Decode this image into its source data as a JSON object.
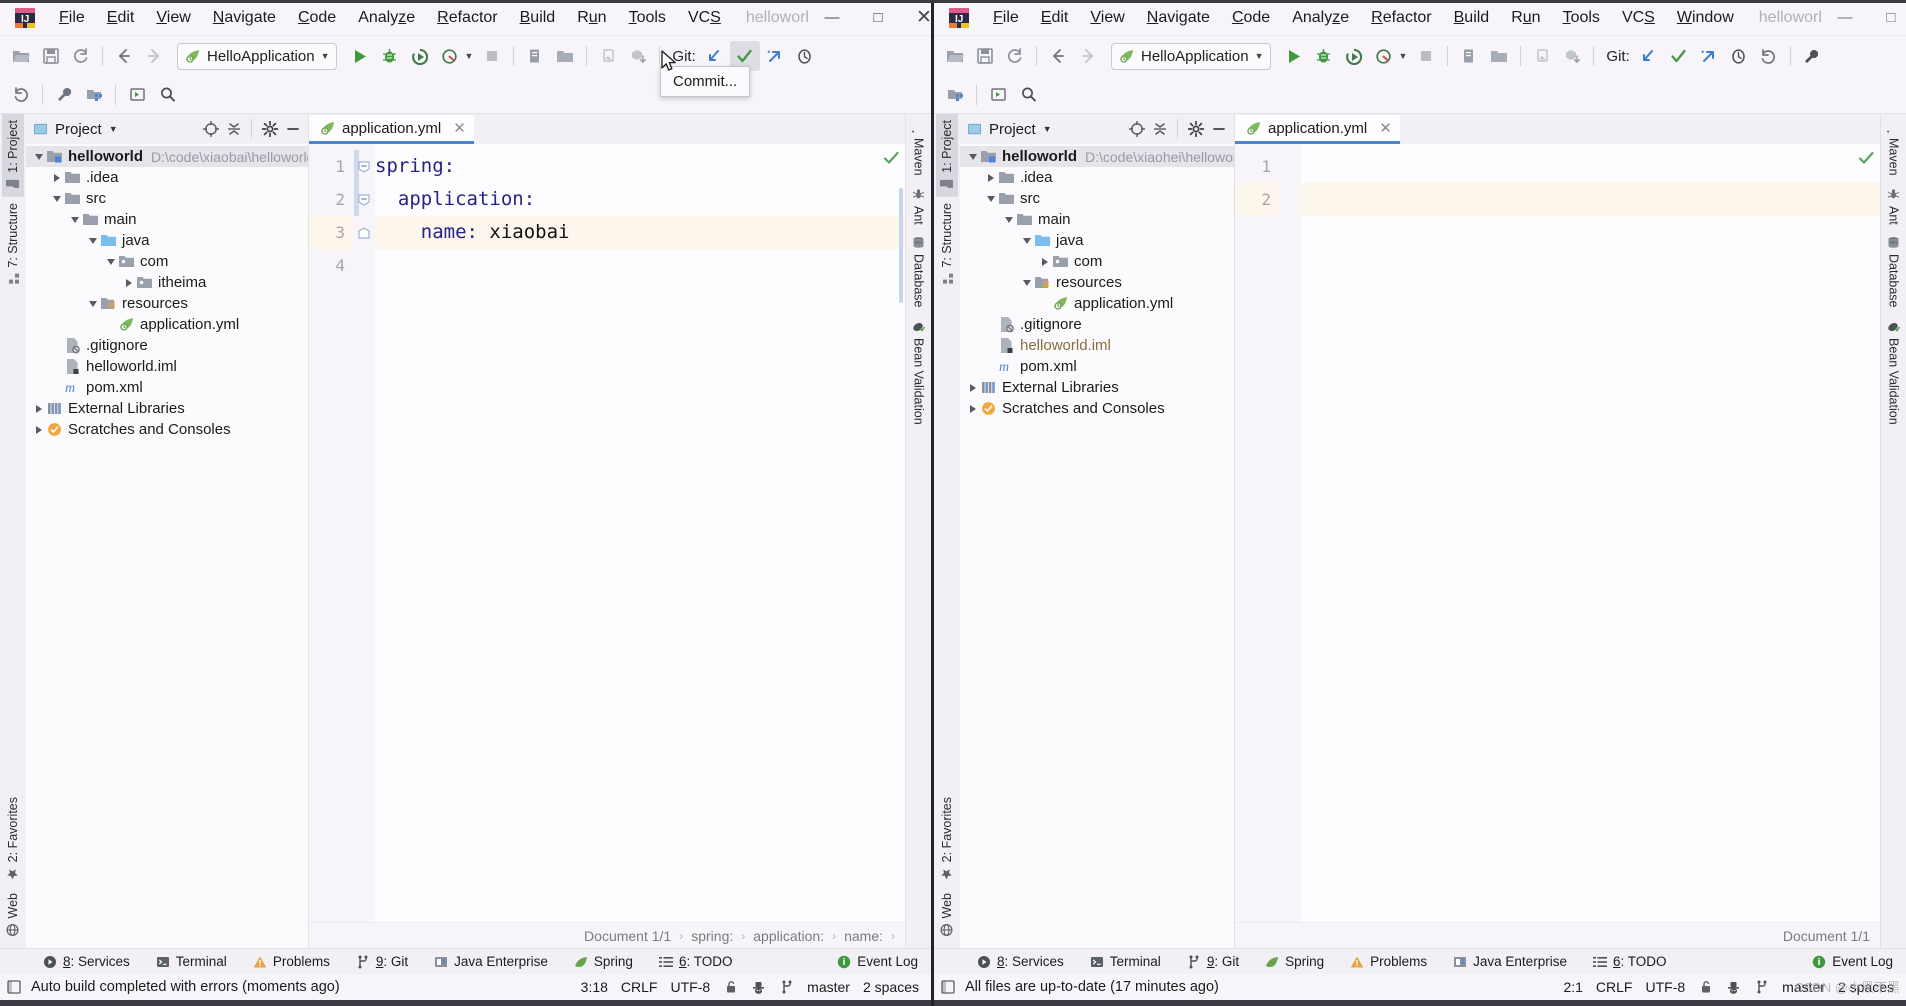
{
  "windows": {
    "left": {
      "title": "helloworl",
      "menu": [
        "File",
        "Edit",
        "View",
        "Navigate",
        "Code",
        "Analyze",
        "Refactor",
        "Build",
        "Run",
        "Tools",
        "VCS"
      ],
      "toolbar": {
        "run_config": "HelloApplication",
        "git_label": "Git:"
      },
      "panel": {
        "title": "Project"
      },
      "tree": [
        {
          "label": "helloworld",
          "path": "D:\\code\\xiaobai\\helloworld",
          "depth": 0,
          "arrow": "down",
          "icon": "module-folder-icon",
          "bold": true,
          "selected": true
        },
        {
          "label": ".idea",
          "path": "",
          "depth": 1,
          "arrow": "right",
          "icon": "folder-icon",
          "bold": false,
          "selected": false
        },
        {
          "label": "src",
          "path": "",
          "depth": 1,
          "arrow": "down",
          "icon": "folder-icon",
          "bold": false,
          "selected": false
        },
        {
          "label": "main",
          "path": "",
          "depth": 2,
          "arrow": "down",
          "icon": "folder-icon",
          "bold": false,
          "selected": false
        },
        {
          "label": "java",
          "path": "",
          "depth": 3,
          "arrow": "down",
          "icon": "source-folder-icon",
          "bold": false,
          "selected": false
        },
        {
          "label": "com",
          "path": "",
          "depth": 4,
          "arrow": "down",
          "icon": "package-icon",
          "bold": false,
          "selected": false
        },
        {
          "label": "itheima",
          "path": "",
          "depth": 5,
          "arrow": "right",
          "icon": "package-icon",
          "bold": false,
          "selected": false
        },
        {
          "label": "resources",
          "path": "",
          "depth": 3,
          "arrow": "down",
          "icon": "resources-folder-icon",
          "bold": false,
          "selected": false
        },
        {
          "label": "application.yml",
          "path": "",
          "depth": 4,
          "arrow": "none",
          "icon": "spring-yaml-icon",
          "bold": false,
          "selected": false
        },
        {
          "label": ".gitignore",
          "path": "",
          "depth": 1,
          "arrow": "none",
          "icon": "gitignore-file-icon",
          "bold": false,
          "selected": false
        },
        {
          "label": "helloworld.iml",
          "path": "",
          "depth": 1,
          "arrow": "none",
          "icon": "iml-file-icon",
          "bold": false,
          "selected": false,
          "orange": false
        },
        {
          "label": "pom.xml",
          "path": "",
          "depth": 1,
          "arrow": "none",
          "icon": "maven-file-icon",
          "bold": false,
          "selected": false
        },
        {
          "label": "External Libraries",
          "path": "",
          "depth": 0,
          "arrow": "right",
          "icon": "libraries-icon",
          "bold": false,
          "selected": false
        },
        {
          "label": "Scratches and Consoles",
          "path": "",
          "depth": 0,
          "arrow": "right",
          "icon": "scratches-icon",
          "bold": false,
          "selected": false
        }
      ],
      "editor": {
        "tab_label": "application.yml",
        "lines": [
          "spring:",
          "  application:",
          "    name: xiaobai",
          ""
        ],
        "line_numbers": [
          "1",
          "2",
          "3",
          "4"
        ],
        "current_line_index": 2
      },
      "breadcrumb": [
        "Document 1/1",
        "spring:",
        "application:",
        "name:"
      ],
      "left_stripe_top": [
        {
          "label": "1: Project",
          "icon": "project-icon",
          "selected": true
        },
        {
          "label": "7: Structure",
          "icon": "structure-icon",
          "selected": false
        }
      ],
      "left_stripe_bottom": [
        {
          "label": "2: Favorites",
          "icon": "star-icon",
          "selected": false
        },
        {
          "label": "Web",
          "icon": "web-icon",
          "selected": false
        }
      ],
      "right_stripe": [
        {
          "label": "Maven",
          "icon": "maven-icon"
        },
        {
          "label": "Ant",
          "icon": "ant-icon"
        },
        {
          "label": "Database",
          "icon": "database-icon"
        },
        {
          "label": "Bean Validation",
          "icon": "bean-validation-icon"
        }
      ],
      "bottom_tabs": [
        {
          "label": "8: Services",
          "icon": "services-icon"
        },
        {
          "label": "Terminal",
          "icon": "terminal-icon"
        },
        {
          "label": "Problems",
          "icon": "warning-icon"
        },
        {
          "label": "9: Git",
          "icon": "git-branch-icon"
        },
        {
          "label": "Java Enterprise",
          "icon": "java-enterprise-icon"
        },
        {
          "label": "Spring",
          "icon": "spring-leaf-icon"
        },
        {
          "label": "6: TODO",
          "icon": "todo-list-icon"
        },
        {
          "label": "Event Log",
          "icon": "event-log-icon"
        }
      ],
      "status": {
        "message": "Auto build completed with errors (moments ago)",
        "caret": "3:18",
        "line_sep": "CRLF",
        "encoding": "UTF-8",
        "branch": "master",
        "indent": "2 spaces"
      },
      "tooltip": "Commit..."
    },
    "right": {
      "title": "helloworl",
      "menu": [
        "File",
        "Edit",
        "View",
        "Navigate",
        "Code",
        "Analyze",
        "Refactor",
        "Build",
        "Run",
        "Tools",
        "VCS",
        "Window"
      ],
      "toolbar": {
        "run_config": "HelloApplication",
        "git_label": "Git:"
      },
      "panel": {
        "title": "Project"
      },
      "tree": [
        {
          "label": "helloworld",
          "path": "D:\\code\\xiaohei\\helloworld",
          "depth": 0,
          "arrow": "down",
          "icon": "module-folder-icon",
          "bold": true,
          "selected": true
        },
        {
          "label": ".idea",
          "path": "",
          "depth": 1,
          "arrow": "right",
          "icon": "folder-icon",
          "bold": false,
          "selected": false
        },
        {
          "label": "src",
          "path": "",
          "depth": 1,
          "arrow": "down",
          "icon": "folder-icon",
          "bold": false,
          "selected": false
        },
        {
          "label": "main",
          "path": "",
          "depth": 2,
          "arrow": "down",
          "icon": "folder-icon",
          "bold": false,
          "selected": false
        },
        {
          "label": "java",
          "path": "",
          "depth": 3,
          "arrow": "down",
          "icon": "source-folder-icon",
          "bold": false,
          "selected": false
        },
        {
          "label": "com",
          "path": "",
          "depth": 4,
          "arrow": "right",
          "icon": "package-icon",
          "bold": false,
          "selected": false
        },
        {
          "label": "resources",
          "path": "",
          "depth": 3,
          "arrow": "down",
          "icon": "resources-folder-icon",
          "bold": false,
          "selected": false
        },
        {
          "label": "application.yml",
          "path": "",
          "depth": 4,
          "arrow": "none",
          "icon": "spring-yaml-icon",
          "bold": false,
          "selected": false
        },
        {
          "label": ".gitignore",
          "path": "",
          "depth": 1,
          "arrow": "none",
          "icon": "gitignore-file-icon",
          "bold": false,
          "selected": false
        },
        {
          "label": "helloworld.iml",
          "path": "",
          "depth": 1,
          "arrow": "none",
          "icon": "iml-file-icon",
          "bold": false,
          "selected": false,
          "orange": true
        },
        {
          "label": "pom.xml",
          "path": "",
          "depth": 1,
          "arrow": "none",
          "icon": "maven-file-icon",
          "bold": false,
          "selected": false
        },
        {
          "label": "External Libraries",
          "path": "",
          "depth": 0,
          "arrow": "right",
          "icon": "libraries-icon",
          "bold": false,
          "selected": false
        },
        {
          "label": "Scratches and Consoles",
          "path": "",
          "depth": 0,
          "arrow": "right",
          "icon": "scratches-icon",
          "bold": false,
          "selected": false
        }
      ],
      "editor": {
        "tab_label": "application.yml",
        "lines": [
          "",
          ""
        ],
        "line_numbers": [
          "1",
          "2"
        ],
        "current_line_index": 1
      },
      "breadcrumb": [
        "Document 1/1"
      ],
      "left_stripe_top": [
        {
          "label": "1: Project",
          "icon": "project-icon",
          "selected": true
        },
        {
          "label": "7: Structure",
          "icon": "structure-icon",
          "selected": false
        }
      ],
      "left_stripe_bottom": [
        {
          "label": "2: Favorites",
          "icon": "star-icon",
          "selected": false
        },
        {
          "label": "Web",
          "icon": "web-icon",
          "selected": false
        }
      ],
      "right_stripe": [
        {
          "label": "Maven",
          "icon": "maven-icon"
        },
        {
          "label": "Ant",
          "icon": "ant-icon"
        },
        {
          "label": "Database",
          "icon": "database-icon"
        },
        {
          "label": "Bean Validation",
          "icon": "bean-validation-icon"
        }
      ],
      "bottom_tabs": [
        {
          "label": "8: Services",
          "icon": "services-icon"
        },
        {
          "label": "Terminal",
          "icon": "terminal-icon"
        },
        {
          "label": "9: Git",
          "icon": "git-branch-icon"
        },
        {
          "label": "Spring",
          "icon": "spring-leaf-icon"
        },
        {
          "label": "Problems",
          "icon": "warning-icon"
        },
        {
          "label": "Java Enterprise",
          "icon": "java-enterprise-icon"
        },
        {
          "label": "6: TODO",
          "icon": "todo-list-icon"
        },
        {
          "label": "Event Log",
          "icon": "event-log-icon"
        }
      ],
      "status": {
        "message": "All files are up-to-date (17 minutes ago)",
        "caret": "2:1",
        "line_sep": "CRLF",
        "encoding": "UTF-8",
        "branch": "master",
        "indent": "2 spaces"
      },
      "watermark": "CSDN @小黑不黑"
    }
  },
  "colors": {
    "accent_blue": "#4a86d8",
    "run_green": "#3f9a3f",
    "git_check": "#3f9a3f",
    "warn_orange": "#e8a33d",
    "folder_gray": "#9aa0ab",
    "source_blue": "#79bdf0"
  }
}
